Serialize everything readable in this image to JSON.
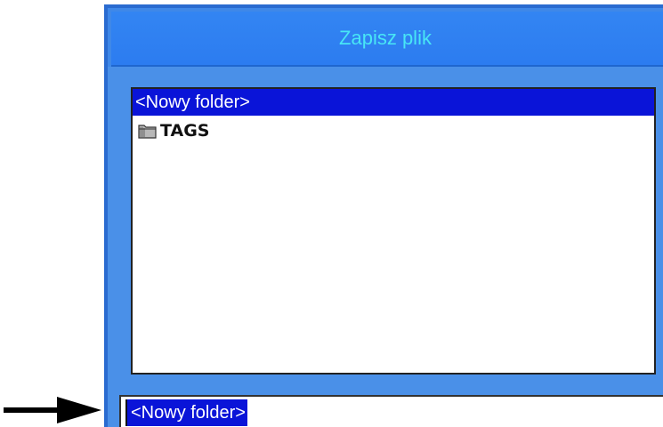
{
  "dialog": {
    "title": "Zapisz plik"
  },
  "file_list": {
    "items": [
      {
        "label": "<Nowy folder>",
        "selected": true,
        "type": "new-folder"
      },
      {
        "label": "TAGS",
        "selected": false,
        "type": "folder",
        "icon": "folder-icon"
      }
    ]
  },
  "name_field": {
    "value": "<Nowy folder>"
  },
  "annotation": {
    "icon": "arrow-right-icon"
  },
  "colors": {
    "dialog_blue": "#3f88e8",
    "title_text": "#48e6f5",
    "selection": "#0a14d8"
  }
}
